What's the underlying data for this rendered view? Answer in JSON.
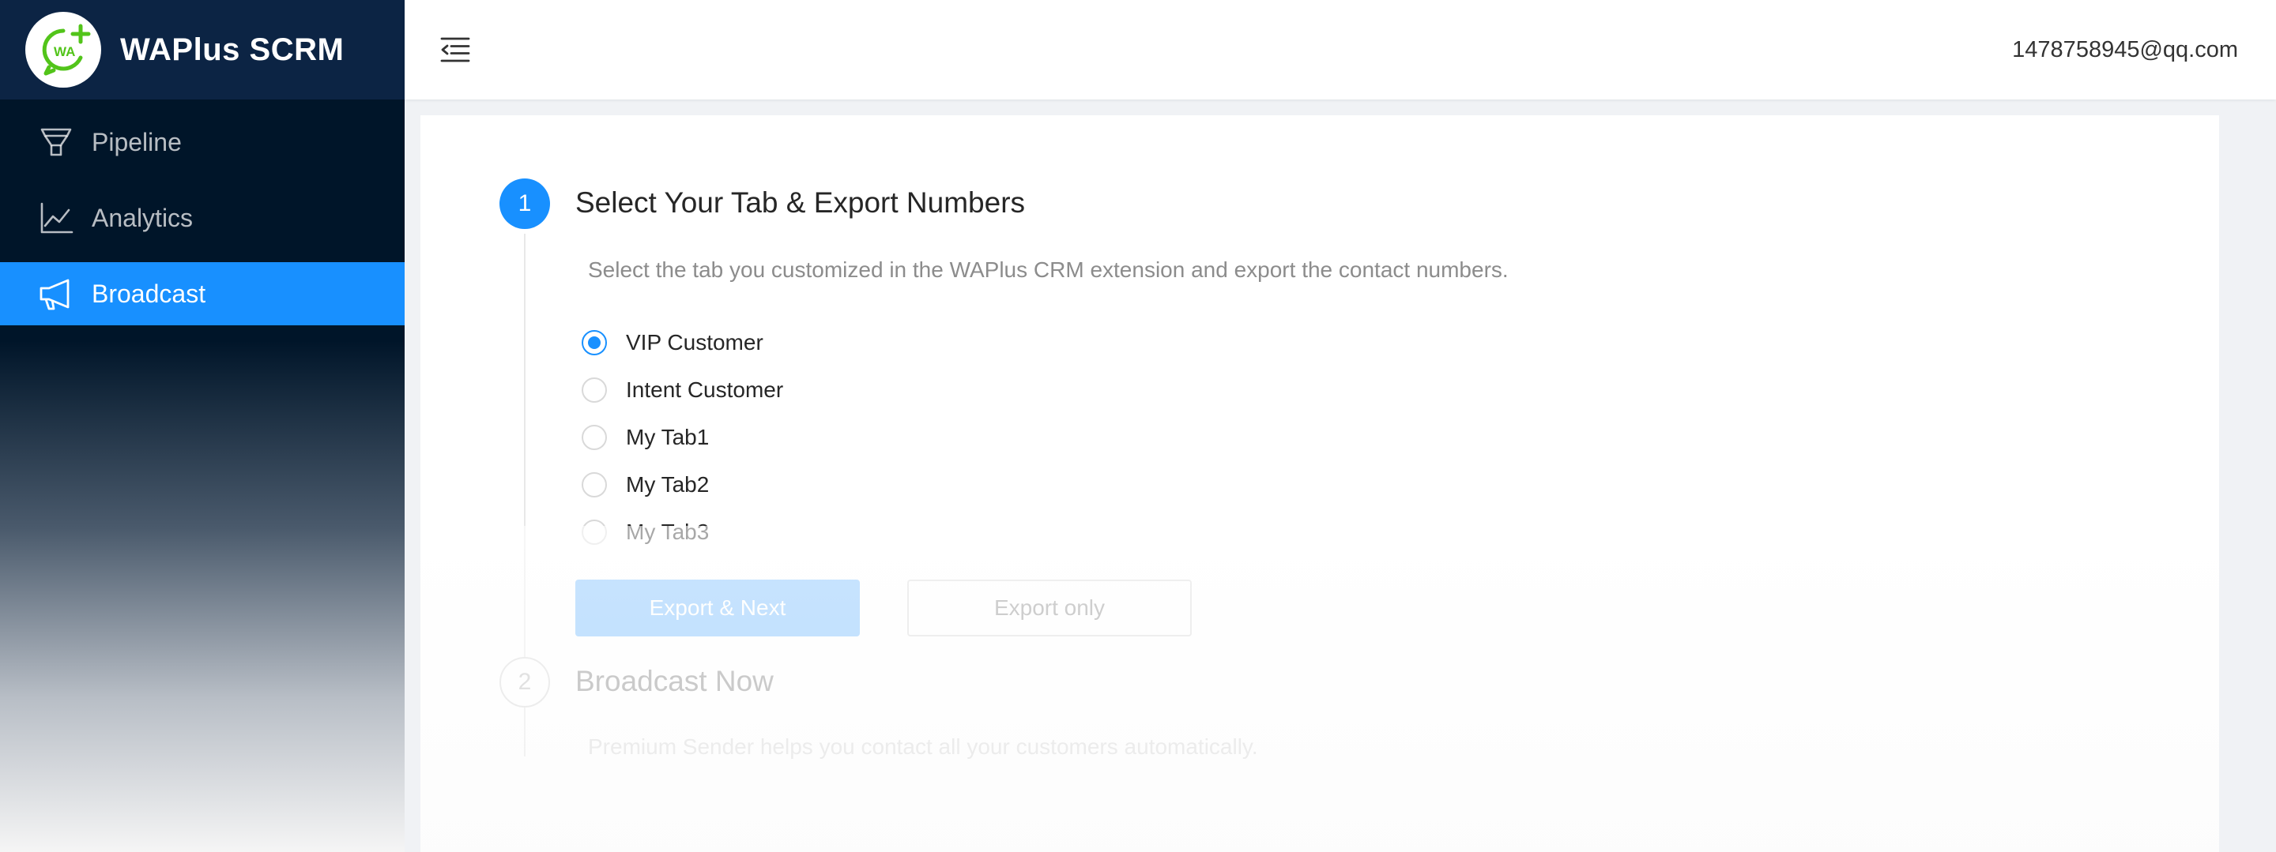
{
  "app": {
    "name": "WAPlus SCRM",
    "logo_text": "WA"
  },
  "sidebar": {
    "items": [
      {
        "label": "Pipeline",
        "icon": "funnel-icon",
        "active": false
      },
      {
        "label": "Analytics",
        "icon": "line-chart-icon",
        "active": false
      },
      {
        "label": "Broadcast",
        "icon": "megaphone-icon",
        "active": true
      }
    ]
  },
  "header": {
    "user_email": "1478758945@qq.com",
    "toggle_icon": "menu-fold-icon"
  },
  "steps": [
    {
      "number": "1",
      "title": "Select Your Tab & Export Numbers",
      "description": "Select the tab you customized in the WAPlus CRM extension and export the contact numbers.",
      "status": "active"
    },
    {
      "number": "2",
      "title": "Broadcast Now",
      "description": "Premium Sender helps you contact all your customers automatically.",
      "status": "waiting"
    }
  ],
  "tab_options": [
    {
      "label": "VIP Customer",
      "checked": true
    },
    {
      "label": "Intent Customer",
      "checked": false
    },
    {
      "label": "My Tab1",
      "checked": false
    },
    {
      "label": "My Tab2",
      "checked": false
    },
    {
      "label": "My Tab3",
      "checked": false
    }
  ],
  "buttons": {
    "export_next": "Export & Next",
    "export_only": "Export only"
  },
  "colors": {
    "primary": "#1890ff",
    "sidebar_dark": "#001529",
    "brand_green": "#52c41a"
  }
}
